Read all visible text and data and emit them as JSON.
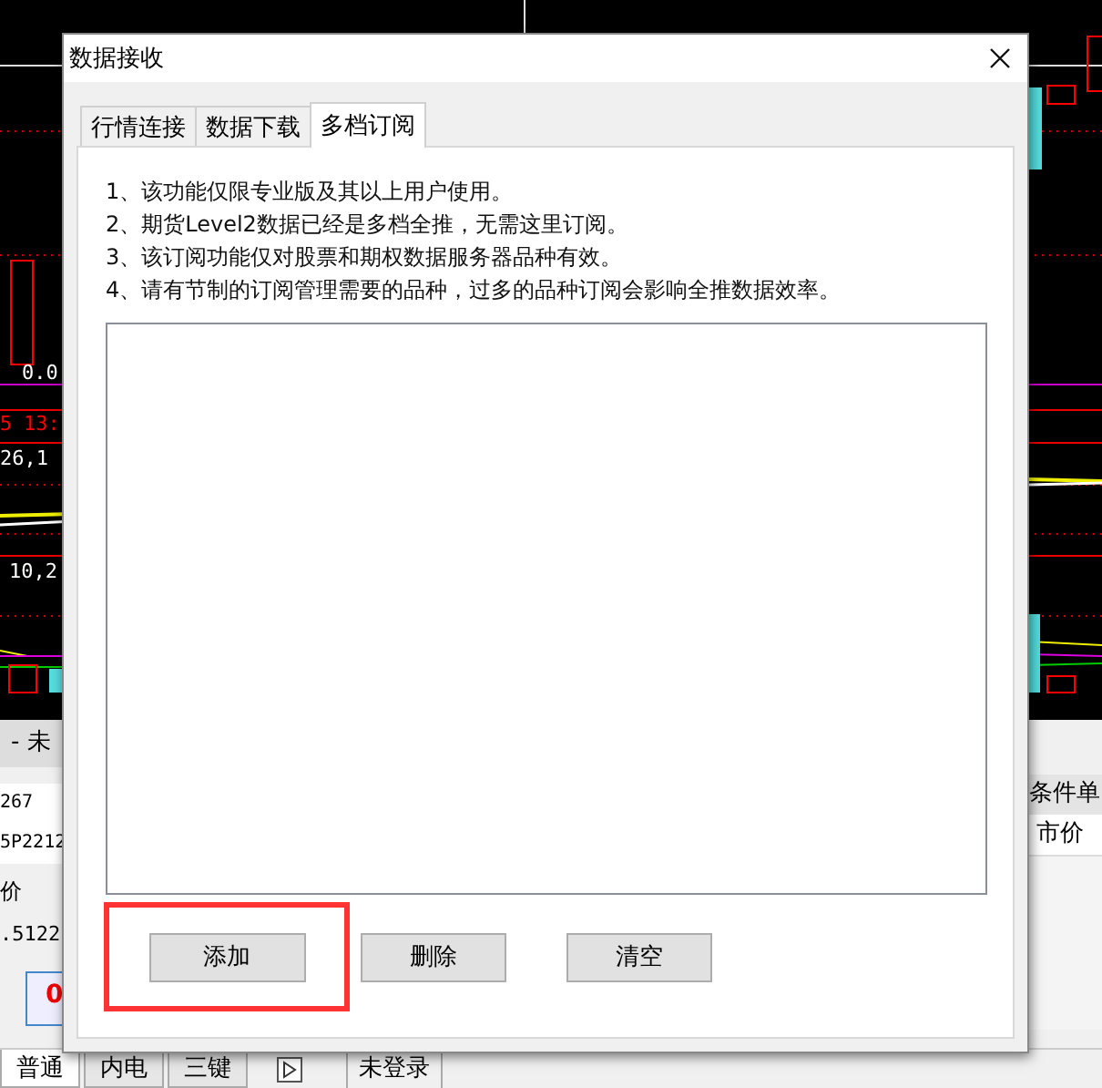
{
  "chart_labels": [
    {
      "text": "0.0",
      "color": "#ffffff"
    },
    {
      "text": "5",
      "color": "#ff0000"
    },
    {
      "text": "13:",
      "color": "#ff0000"
    },
    {
      "text": "26,1",
      "color": "#ffffff"
    },
    {
      "text": "10,2",
      "color": "#ffffff"
    }
  ],
  "order_panel": {
    "title": "- 未",
    "fields": [
      "267",
      "5P2212"
    ],
    "price_label": "价",
    "price": ".5122",
    "badge": "0"
  },
  "right_panel": {
    "tab": "条件单",
    "cell": "市价"
  },
  "bottom_tabs": [
    {
      "label": "普通",
      "selected": true
    },
    {
      "label": "内电",
      "selected": false
    },
    {
      "label": "三键",
      "selected": false
    }
  ],
  "status": "未登录",
  "dialog": {
    "title": "数据接收",
    "tabs": [
      {
        "label": "行情连接",
        "selected": false
      },
      {
        "label": "数据下载",
        "selected": false
      },
      {
        "label": "多档订阅",
        "selected": true
      }
    ],
    "notes": [
      "1、该功能仅限专业版及其以上用户使用。",
      "2、期货Level2数据已经是多档全推，无需这里订阅。",
      "3、该订阅功能仅对股票和期权数据服务器品种有效。",
      "4、请有节制的订阅管理需要的品种，过多的品种订阅会影响全推数据效率。"
    ],
    "buttons": [
      {
        "label": "添加",
        "highlighted": true
      },
      {
        "label": "删除",
        "highlighted": false
      },
      {
        "label": "清空",
        "highlighted": false
      }
    ]
  }
}
